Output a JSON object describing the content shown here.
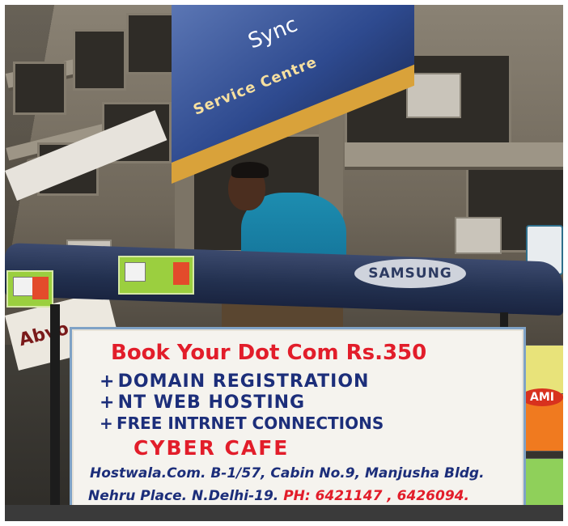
{
  "photo": {
    "building_banner": {
      "brand_text": "Sync",
      "service_text": "Service Centre"
    },
    "left_shop_text": "Abvo",
    "canopy_badge": "SAMSUNG",
    "right_poster_badge": "AMI",
    "sign": {
      "headline": "Book Your Dot Com Rs.350",
      "bullets": [
        "DOMAIN REGISTRATION",
        "NT WEB HOSTING",
        "FREE INTRNET CONNECTIONS"
      ],
      "bullet_marker": "+",
      "subheadline": "CYBER CAFE",
      "address_line": "Hostwala.Com. B-1/57, Cabin No.9, Manjusha Bldg.",
      "city_line": "Nehru Place. N.Delhi-19.",
      "phone_line": "PH: 6421147 , 6426094."
    },
    "colors": {
      "sign_red": "#e21d2a",
      "sign_blue": "#1c2e7a",
      "shirt": "#1d8db0",
      "banner_blue": "#2e4a8f"
    }
  }
}
